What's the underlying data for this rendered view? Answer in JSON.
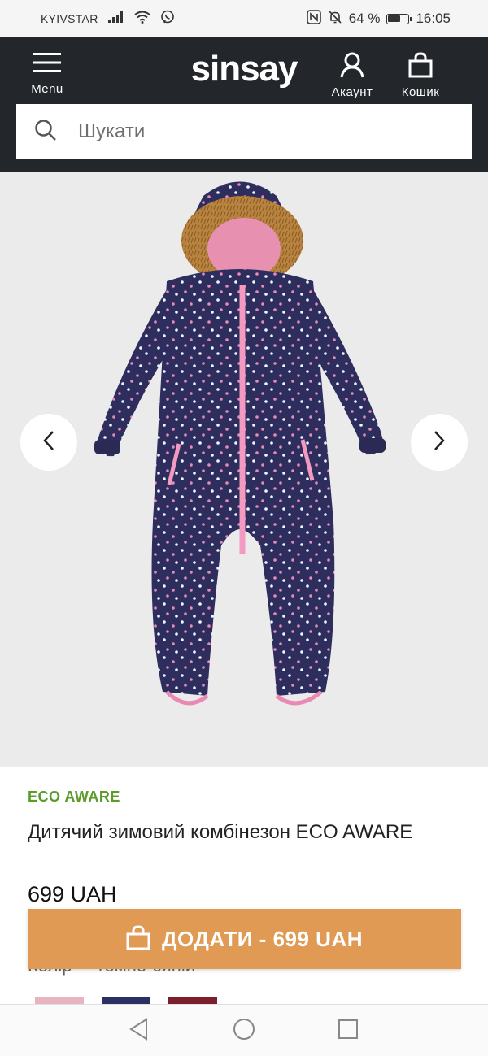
{
  "status_bar": {
    "carrier": "KYIVSTAR",
    "battery_percent": "64 %",
    "battery_level": 0.64,
    "time": "16:05"
  },
  "header": {
    "menu_label": "Menu",
    "logo": "sinsay",
    "account_label": "Акаунт",
    "cart_label": "Кошик",
    "search_placeholder": "Шукати"
  },
  "product": {
    "badge": "ECO AWARE",
    "title": "Дитячий зимовий комбінезон ECO AWARE",
    "price": "699 UAH",
    "color_label": "Колір",
    "color_name": "темно-синій",
    "swatches": [
      "#e8b4c0",
      "#2b2f63",
      "#7a1f2b"
    ]
  },
  "cta": {
    "label": "ДОДАТИ - 699 UAH"
  },
  "colors": {
    "header_bg": "#23272c",
    "accent": "#e09a54",
    "eco_green": "#5b9b2a",
    "gallery_bg": "#ebebeb"
  }
}
